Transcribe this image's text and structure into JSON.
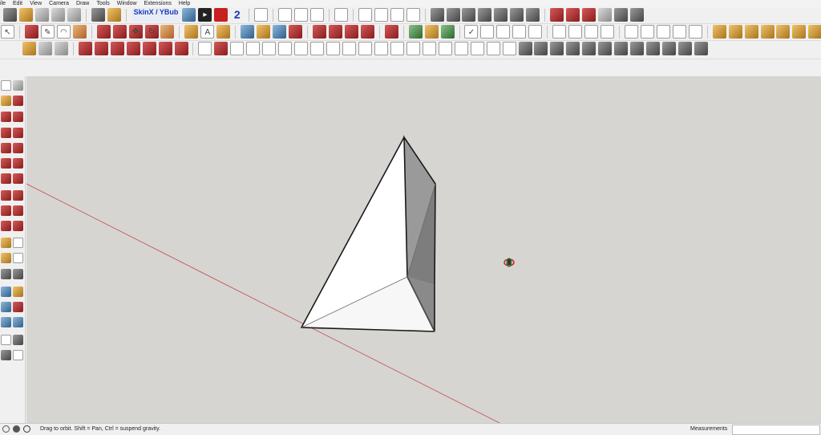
{
  "menu": {
    "items": [
      "ile",
      "Edit",
      "View",
      "Camera",
      "Draw",
      "Tools",
      "Window",
      "Extensions",
      "Help"
    ]
  },
  "toolbar": {
    "skinx_label": "SkinX / YBub"
  },
  "status": {
    "message": "Drag to orbit. Shift = Pan, Ctrl = suspend gravity.",
    "measurements_label": "Measurements",
    "measurements_value": ""
  },
  "colors": {
    "viewport_background": "#d7d5d2",
    "red_axis": "#c0504d",
    "model_face": "#ffffff",
    "model_shade": "#8e8e8e",
    "model_edge": "#1a1a1a"
  }
}
